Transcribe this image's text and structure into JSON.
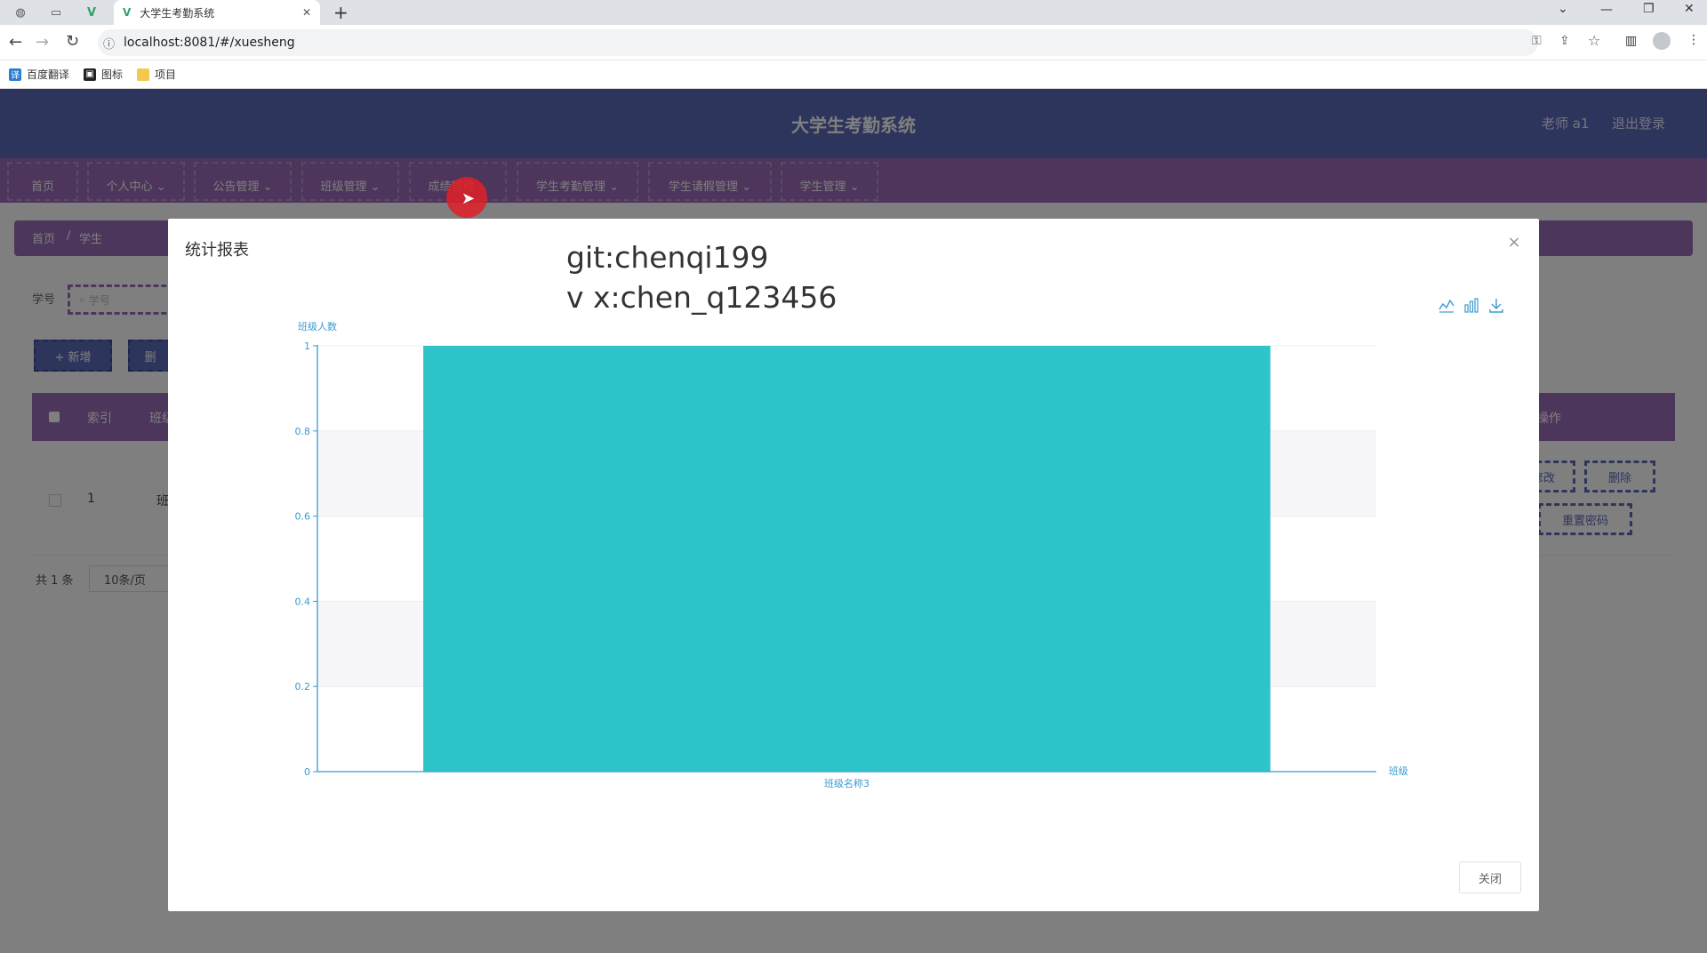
{
  "browser": {
    "tab_title": "大学生考勤系统",
    "new_tab": "+",
    "url": "localhost:8081/#/xuesheng",
    "bookmarks": [
      {
        "label": "百度翻译"
      },
      {
        "label": "图标"
      },
      {
        "label": "项目"
      }
    ]
  },
  "app": {
    "title": "大学生考勤系统",
    "user": "老师 a1",
    "logout": "退出登录",
    "nav": [
      {
        "label": "首页"
      },
      {
        "label": "个人中心 ⌄"
      },
      {
        "label": "公告管理 ⌄"
      },
      {
        "label": "班级管理 ⌄"
      },
      {
        "label": "成绩管理 ⌄"
      },
      {
        "label": "学生考勤管理 ⌄"
      },
      {
        "label": "学生请假管理 ⌄"
      },
      {
        "label": "学生管理 ⌄"
      }
    ],
    "breadcrumb": {
      "home": "首页",
      "sep": "/",
      "current": "学生"
    },
    "search": {
      "label": "学号",
      "placeholder": "学号"
    },
    "buttons": {
      "add": "+ 新增",
      "delete": "删"
    },
    "table": {
      "headers": {
        "index": "索引",
        "class": "班级",
        "op": "操作"
      },
      "rows": [
        {
          "index": "1",
          "class": "班"
        }
      ],
      "row_ops": {
        "edit": "修改",
        "delete": "删除",
        "reset": "重置密码"
      }
    },
    "pager": {
      "total": "共 1 条",
      "size": "10条/页"
    }
  },
  "dialog": {
    "title": "统计报表",
    "watermark_line1": "git:chenqi199",
    "watermark_line2": "v x:chen_q123456",
    "close_button": "关闭",
    "close_x": "×"
  },
  "chart_data": {
    "type": "bar",
    "categories": [
      "班级名称3"
    ],
    "series": [
      {
        "values": [
          1
        ]
      }
    ],
    "xlabel": "班级",
    "ylabel": "班级人数",
    "ylim": [
      0,
      1
    ],
    "yticks": [
      "0",
      "0.2",
      "0.4",
      "0.6",
      "0.8",
      "1"
    ],
    "bar_color": "#2ec4c9",
    "axis_color": "#3a9bd0",
    "toolbox": [
      "line-chart-icon",
      "bar-chart-icon",
      "download-icon"
    ]
  },
  "colors": {
    "header": "#5c6bb8",
    "nav": "#9a6ab6",
    "accent": "#9b6cb6"
  }
}
